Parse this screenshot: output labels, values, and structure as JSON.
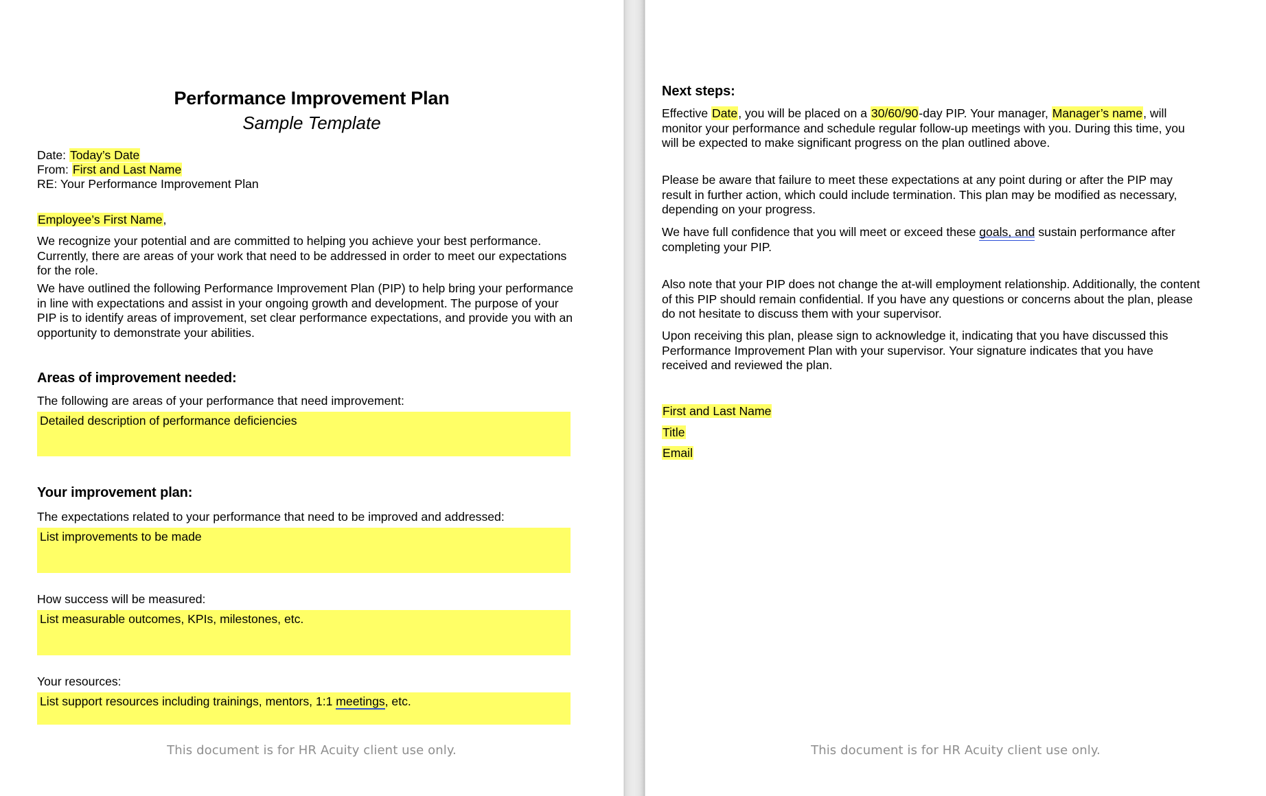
{
  "document": {
    "title": "Performance Improvement Plan",
    "subtitle": "Sample Template",
    "footer_note": "This document is for HR Acuity client use only."
  },
  "colors": {
    "highlight": "#ffff66",
    "text": "#000000",
    "footer_text": "#8e8e8e",
    "spellcheck_underline": "#2b4fd8",
    "gutter": "#e9e9e9"
  },
  "page_one": {
    "meta": {
      "date_label": "Date:",
      "date_value": "Today’s Date",
      "from_label": "From:",
      "from_value": "First and Last Name",
      "re_line": "RE: Your Performance Improvement Plan"
    },
    "salutation": {
      "name": "Employee’s First Name",
      "comma": ","
    },
    "paragraphs": [
      "We recognize your potential and are committed to helping you achieve your best performance. Currently, there are areas of your work that need to be addressed in order to meet our expectations for the role.",
      "We have outlined the following Performance Improvement Plan (PIP) to help bring your performance in line with expectations and assist in your ongoing growth and development. The purpose of your PIP is to identify areas of improvement, set clear performance expectations, and provide you with an opportunity to demonstrate your abilities."
    ],
    "areas_section": {
      "heading": "Areas of improvement needed:",
      "intro": "The following are areas of your performance that need improvement:",
      "fill_placeholder": "Detailed description of performance deficiencies"
    },
    "plan_section": {
      "heading": "Your improvement plan:",
      "intro": "The expectations related to your performance that need to be improved and addressed:",
      "fill_placeholder": "List improvements to be made",
      "success_label": "How success will be measured:",
      "success_fill_placeholder": "List measurable outcomes, KPIs, milestones, etc.",
      "resources_label": "Your resources:",
      "resources_fill_prefix": "List support resources including trainings, mentors, 1:1 ",
      "resources_fill_spellcheck_word": "meetings",
      "resources_fill_suffix": ", etc."
    }
  },
  "page_two": {
    "next_steps": {
      "heading": "Next steps:",
      "p1_a": "Effective ",
      "p1_hl_date": "Date",
      "p1_b": ", you will be placed on a ",
      "p1_hl_duration": "30/60/90",
      "p1_c": "-day PIP. Your manager, ",
      "p1_hl_manager": "Manager’s name",
      "p1_d": ", will monitor your performance and schedule regular follow-up meetings with you. During this time, you will be expected to make significant progress on the plan outlined above.",
      "p2": "Please be aware that failure to meet these expectations at any point during or after the PIP may result in further action, which could include termination. This plan may be modified as necessary, depending on your progress.",
      "p3_a": "We have full confidence that you will meet or exceed these ",
      "p3_grammar": "goals, and",
      "p3_b": " sustain performance after completing your PIP.",
      "p4": "Also note that your PIP does not change the at-will employment relationship. Additionally, the content of this PIP should remain confidential. If you have any questions or concerns about the plan, please do not hesitate to discuss them with your supervisor.",
      "p5": "Upon receiving this plan, please sign to acknowledge it, indicating that you have discussed this Performance Improvement Plan with your supervisor. Your signature indicates that you have received and reviewed the plan."
    },
    "signature_block": {
      "name": "First and Last Name",
      "title": "Title",
      "email": "Email"
    }
  }
}
